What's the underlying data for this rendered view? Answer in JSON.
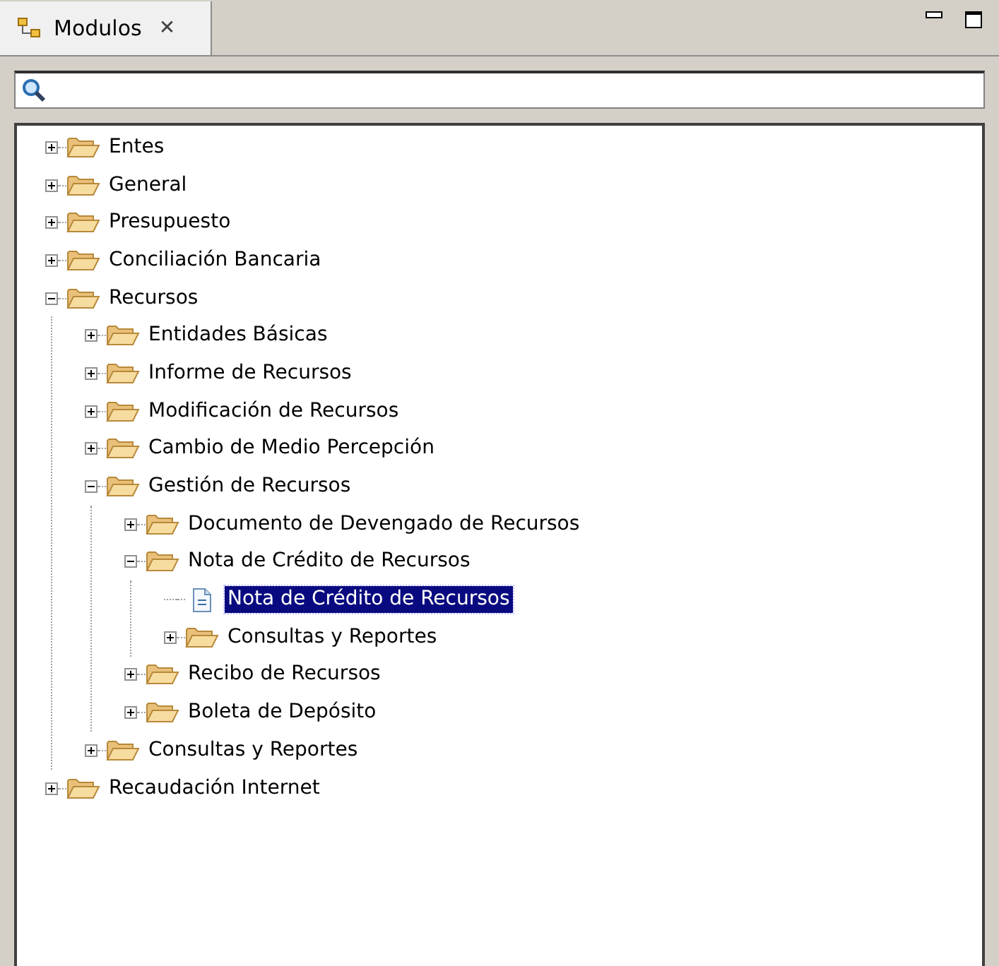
{
  "view": {
    "title": "Modulos",
    "close_label": "✕"
  },
  "tree": [
    {
      "label": "Entes",
      "kind": "folder",
      "expanded": false,
      "selected": false
    },
    {
      "label": "General",
      "kind": "folder",
      "expanded": false,
      "selected": false
    },
    {
      "label": "Presupuesto",
      "kind": "folder",
      "expanded": false,
      "selected": false
    },
    {
      "label": "Conciliación Bancaria",
      "kind": "folder",
      "expanded": false,
      "selected": false
    },
    {
      "label": "Recursos",
      "kind": "folder",
      "expanded": true,
      "selected": false,
      "children": [
        {
          "label": "Entidades Básicas",
          "kind": "folder",
          "expanded": false,
          "selected": false
        },
        {
          "label": "Informe de Recursos",
          "kind": "folder",
          "expanded": false,
          "selected": false
        },
        {
          "label": "Modificación de Recursos",
          "kind": "folder",
          "expanded": false,
          "selected": false
        },
        {
          "label": "Cambio de Medio Percepción",
          "kind": "folder",
          "expanded": false,
          "selected": false
        },
        {
          "label": "Gestión de Recursos",
          "kind": "folder",
          "expanded": true,
          "selected": false,
          "children": [
            {
              "label": "Documento de Devengado de Recursos",
              "kind": "folder",
              "expanded": false,
              "selected": false
            },
            {
              "label": "Nota de Crédito de Recursos",
              "kind": "folder",
              "expanded": true,
              "selected": false,
              "children": [
                {
                  "label": "Nota de Crédito de Recursos",
                  "kind": "file",
                  "selected": true
                },
                {
                  "label": "Consultas y Reportes",
                  "kind": "folder",
                  "expanded": false,
                  "selected": false
                }
              ]
            },
            {
              "label": "Recibo de Recursos",
              "kind": "folder",
              "expanded": false,
              "selected": false
            },
            {
              "label": "Boleta de Depósito",
              "kind": "folder",
              "expanded": false,
              "selected": false
            }
          ]
        },
        {
          "label": "Consultas y Reportes",
          "kind": "folder",
          "expanded": false,
          "selected": false
        }
      ]
    },
    {
      "label": "Recaudación Internet",
      "kind": "folder",
      "expanded": false,
      "selected": false
    }
  ]
}
